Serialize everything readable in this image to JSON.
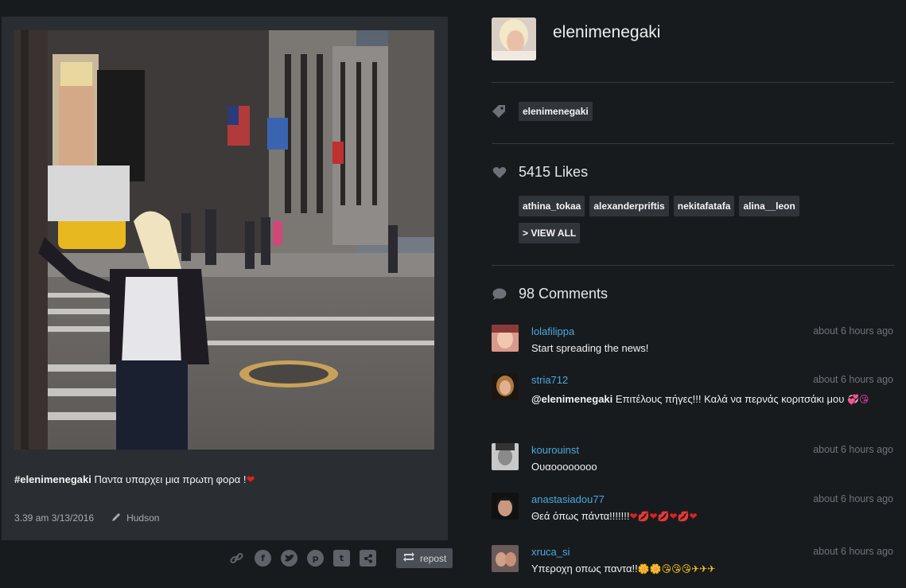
{
  "post": {
    "caption_tag": "#elenimenegaki",
    "caption_text": " Παντα υπαρχει μια πρωτη φορα !",
    "caption_emoji": "❤",
    "datetime": "3.39 am 3/13/2016",
    "filter": "Hudson"
  },
  "share": {
    "repost_label": "repost",
    "icons": [
      "link-icon",
      "facebook-icon",
      "twitter-icon",
      "pinterest-icon",
      "tumblr-icon",
      "share-icon"
    ]
  },
  "profile": {
    "username": "elenimenegaki"
  },
  "tags": [
    "elenimenegaki"
  ],
  "likes": {
    "label": "5415 Likes",
    "users": [
      "athina_tokaa",
      "alexanderpriftis",
      "nekitafatafa",
      "alina__leon"
    ],
    "view_all": "> VIEW ALL"
  },
  "comments": {
    "label": "98 Comments",
    "items": [
      {
        "user": "lolafilippa",
        "time": "about 6 hours ago",
        "text": "Start spreading the news!",
        "mention": "",
        "emoji": ""
      },
      {
        "user": "stria712",
        "time": "about 6 hours ago",
        "mention": "@elenimenegaki",
        "text": " Επιτέλους πήγες!!! Καλά να περνάς κοριτσάκι μου ",
        "emoji": "💞😘"
      },
      {
        "user": "kourouinst",
        "time": "about 6 hours ago",
        "text": "Ουαοοοοοοοο",
        "mention": "",
        "emoji": ""
      },
      {
        "user": "anastasiadou77",
        "time": "about 6 hours ago",
        "text": "Θεά όπως πάντα!!!!!!!",
        "mention": "",
        "emoji": "❤💋❤💋❤💋❤"
      },
      {
        "user": "xruca_si",
        "time": "about 6 hours ago",
        "text": "Υπεροχη οπως παντα!!",
        "mention": "",
        "emoji": "🌼🌼😘😘😘✈✈✈"
      }
    ]
  },
  "colors": {
    "background": "#181b1e",
    "card": "#2a2e33",
    "link": "#4aa8e0",
    "pill": "#30353a"
  }
}
